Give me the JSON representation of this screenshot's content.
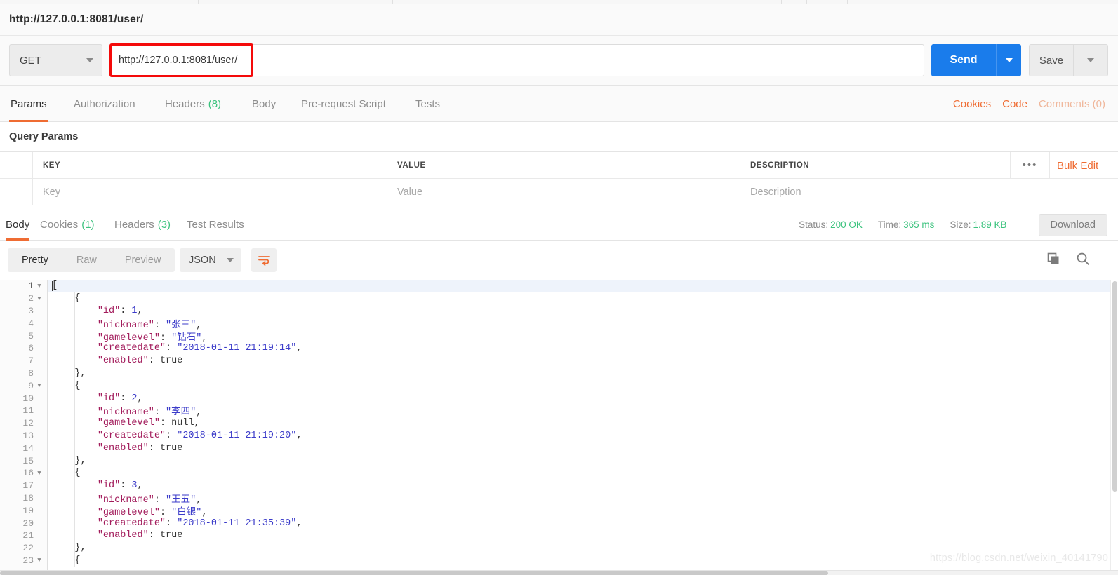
{
  "request": {
    "title": "http://127.0.0.1:8081/user/",
    "method": "GET",
    "url": "http://127.0.0.1:8081/user/",
    "send_label": "Send",
    "save_label": "Save"
  },
  "request_tabs": [
    {
      "label": "Params",
      "count": "",
      "active": true
    },
    {
      "label": "Authorization",
      "count": "",
      "active": false
    },
    {
      "label": "Headers",
      "count": "(8)",
      "active": false
    },
    {
      "label": "Body",
      "count": "",
      "active": false
    },
    {
      "label": "Pre-request Script",
      "count": "",
      "active": false
    },
    {
      "label": "Tests",
      "count": "",
      "active": false
    }
  ],
  "request_links": {
    "cookies": "Cookies",
    "code": "Code",
    "comments": "Comments (0)"
  },
  "query_params": {
    "section_title": "Query Params",
    "headers": {
      "key": "KEY",
      "value": "VALUE",
      "description": "DESCRIPTION"
    },
    "placeholders": {
      "key": "Key",
      "value": "Value",
      "description": "Description"
    },
    "bulk_edit": "Bulk Edit"
  },
  "response_tabs": [
    {
      "label": "Body",
      "count": "",
      "active": true
    },
    {
      "label": "Cookies",
      "count": "(1)",
      "active": false
    },
    {
      "label": "Headers",
      "count": "(3)",
      "active": false
    },
    {
      "label": "Test Results",
      "count": "",
      "active": false
    }
  ],
  "response_status": {
    "status_label": "Status:",
    "status_value": "200 OK",
    "time_label": "Time:",
    "time_value": "365 ms",
    "size_label": "Size:",
    "size_value": "1.89 KB",
    "download_label": "Download"
  },
  "response_toolbar": {
    "view_modes": [
      "Pretty",
      "Raw",
      "Preview"
    ],
    "active_view": "Pretty",
    "format": "JSON"
  },
  "colors": {
    "accent_orange": "#ef6c33",
    "send_blue": "#1a7ceb",
    "status_green": "#3cc37e",
    "annotation_red": "#f40a0a",
    "json_key": "#a21b5b",
    "json_string": "#3b3bc9"
  },
  "response_body": {
    "lines": [
      {
        "n": "1",
        "fold": true,
        "indent": 0,
        "tokens": [
          {
            "t": "[",
            "c": "p"
          }
        ]
      },
      {
        "n": "2",
        "fold": true,
        "indent": 1,
        "tokens": [
          {
            "t": "{",
            "c": "p"
          }
        ]
      },
      {
        "n": "3",
        "fold": false,
        "indent": 2,
        "tokens": [
          {
            "t": "\"id\"",
            "c": "k"
          },
          {
            "t": ": ",
            "c": "p"
          },
          {
            "t": "1",
            "c": "n"
          },
          {
            "t": ",",
            "c": "p"
          }
        ]
      },
      {
        "n": "4",
        "fold": false,
        "indent": 2,
        "tokens": [
          {
            "t": "\"nickname\"",
            "c": "k"
          },
          {
            "t": ": ",
            "c": "p"
          },
          {
            "t": "\"张三\"",
            "c": "s"
          },
          {
            "t": ",",
            "c": "p"
          }
        ]
      },
      {
        "n": "5",
        "fold": false,
        "indent": 2,
        "tokens": [
          {
            "t": "\"gamelevel\"",
            "c": "k"
          },
          {
            "t": ": ",
            "c": "p"
          },
          {
            "t": "\"钻石\"",
            "c": "s"
          },
          {
            "t": ",",
            "c": "p"
          }
        ]
      },
      {
        "n": "6",
        "fold": false,
        "indent": 2,
        "tokens": [
          {
            "t": "\"createdate\"",
            "c": "k"
          },
          {
            "t": ": ",
            "c": "p"
          },
          {
            "t": "\"2018-01-11 21:19:14\"",
            "c": "s"
          },
          {
            "t": ",",
            "c": "p"
          }
        ]
      },
      {
        "n": "7",
        "fold": false,
        "indent": 2,
        "tokens": [
          {
            "t": "\"enabled\"",
            "c": "k"
          },
          {
            "t": ": ",
            "c": "p"
          },
          {
            "t": "true",
            "c": "p"
          }
        ]
      },
      {
        "n": "8",
        "fold": false,
        "indent": 1,
        "tokens": [
          {
            "t": "},",
            "c": "p"
          }
        ]
      },
      {
        "n": "9",
        "fold": true,
        "indent": 1,
        "tokens": [
          {
            "t": "{",
            "c": "p"
          }
        ]
      },
      {
        "n": "10",
        "fold": false,
        "indent": 2,
        "tokens": [
          {
            "t": "\"id\"",
            "c": "k"
          },
          {
            "t": ": ",
            "c": "p"
          },
          {
            "t": "2",
            "c": "n"
          },
          {
            "t": ",",
            "c": "p"
          }
        ]
      },
      {
        "n": "11",
        "fold": false,
        "indent": 2,
        "tokens": [
          {
            "t": "\"nickname\"",
            "c": "k"
          },
          {
            "t": ": ",
            "c": "p"
          },
          {
            "t": "\"李四\"",
            "c": "s"
          },
          {
            "t": ",",
            "c": "p"
          }
        ]
      },
      {
        "n": "12",
        "fold": false,
        "indent": 2,
        "tokens": [
          {
            "t": "\"gamelevel\"",
            "c": "k"
          },
          {
            "t": ": ",
            "c": "p"
          },
          {
            "t": "null",
            "c": "p"
          },
          {
            "t": ",",
            "c": "p"
          }
        ]
      },
      {
        "n": "13",
        "fold": false,
        "indent": 2,
        "tokens": [
          {
            "t": "\"createdate\"",
            "c": "k"
          },
          {
            "t": ": ",
            "c": "p"
          },
          {
            "t": "\"2018-01-11 21:19:20\"",
            "c": "s"
          },
          {
            "t": ",",
            "c": "p"
          }
        ]
      },
      {
        "n": "14",
        "fold": false,
        "indent": 2,
        "tokens": [
          {
            "t": "\"enabled\"",
            "c": "k"
          },
          {
            "t": ": ",
            "c": "p"
          },
          {
            "t": "true",
            "c": "p"
          }
        ]
      },
      {
        "n": "15",
        "fold": false,
        "indent": 1,
        "tokens": [
          {
            "t": "},",
            "c": "p"
          }
        ]
      },
      {
        "n": "16",
        "fold": true,
        "indent": 1,
        "tokens": [
          {
            "t": "{",
            "c": "p"
          }
        ]
      },
      {
        "n": "17",
        "fold": false,
        "indent": 2,
        "tokens": [
          {
            "t": "\"id\"",
            "c": "k"
          },
          {
            "t": ": ",
            "c": "p"
          },
          {
            "t": "3",
            "c": "n"
          },
          {
            "t": ",",
            "c": "p"
          }
        ]
      },
      {
        "n": "18",
        "fold": false,
        "indent": 2,
        "tokens": [
          {
            "t": "\"nickname\"",
            "c": "k"
          },
          {
            "t": ": ",
            "c": "p"
          },
          {
            "t": "\"王五\"",
            "c": "s"
          },
          {
            "t": ",",
            "c": "p"
          }
        ]
      },
      {
        "n": "19",
        "fold": false,
        "indent": 2,
        "tokens": [
          {
            "t": "\"gamelevel\"",
            "c": "k"
          },
          {
            "t": ": ",
            "c": "p"
          },
          {
            "t": "\"白银\"",
            "c": "s"
          },
          {
            "t": ",",
            "c": "p"
          }
        ]
      },
      {
        "n": "20",
        "fold": false,
        "indent": 2,
        "tokens": [
          {
            "t": "\"createdate\"",
            "c": "k"
          },
          {
            "t": ": ",
            "c": "p"
          },
          {
            "t": "\"2018-01-11 21:35:39\"",
            "c": "s"
          },
          {
            "t": ",",
            "c": "p"
          }
        ]
      },
      {
        "n": "21",
        "fold": false,
        "indent": 2,
        "tokens": [
          {
            "t": "\"enabled\"",
            "c": "k"
          },
          {
            "t": ": ",
            "c": "p"
          },
          {
            "t": "true",
            "c": "p"
          }
        ]
      },
      {
        "n": "22",
        "fold": false,
        "indent": 1,
        "tokens": [
          {
            "t": "},",
            "c": "p"
          }
        ]
      },
      {
        "n": "23",
        "fold": true,
        "indent": 1,
        "tokens": [
          {
            "t": "{",
            "c": "p"
          }
        ]
      }
    ]
  },
  "watermark": "https://blog.csdn.net/weixin_40141790"
}
